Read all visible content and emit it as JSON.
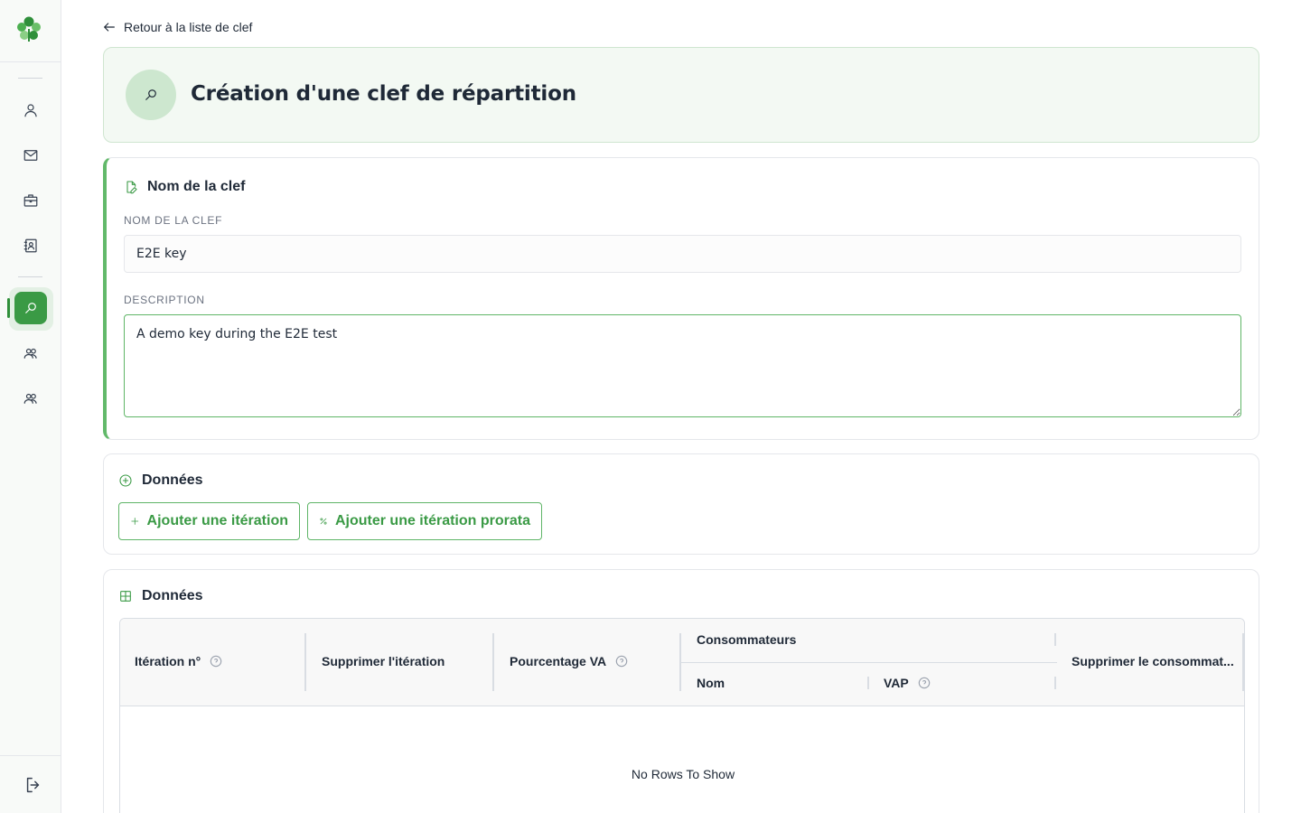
{
  "app": {
    "brand_color": "#3a9a45",
    "logo_icon": "clover-logo-icon"
  },
  "sidebar": {
    "items": [
      {
        "id": "users",
        "icon": "user-icon",
        "active": false
      },
      {
        "id": "mail",
        "icon": "mail-icon",
        "active": false
      },
      {
        "id": "briefcase",
        "icon": "briefcase-icon",
        "active": false
      },
      {
        "id": "contacts",
        "icon": "contact-book-icon",
        "active": false
      },
      {
        "id": "keys",
        "icon": "key-search-icon",
        "active": true
      },
      {
        "id": "group1",
        "icon": "users-group-icon",
        "active": false
      },
      {
        "id": "group2",
        "icon": "users-group-icon",
        "active": false
      }
    ],
    "logout_icon": "logout-icon"
  },
  "back_link": {
    "label": "Retour à la liste de clef"
  },
  "header": {
    "title": "Création d'une clef de répartition"
  },
  "name_section": {
    "title": "Nom de la clef",
    "name_label": "NOM DE LA CLEF",
    "name_value": "E2E key",
    "description_label": "DESCRIPTION",
    "description_value": "A demo key during the E2E test"
  },
  "actions_section": {
    "title": "Données",
    "add_iteration_label": "Ajouter une itération",
    "add_prorata_label": "Ajouter une itération prorata"
  },
  "table_section": {
    "title": "Données",
    "columns": {
      "iteration": "Itération n°",
      "delete_iteration": "Supprimer l'itération",
      "va_percentage": "Pourcentage VA",
      "consumers_group": "Consommateurs",
      "consumer_name": "Nom",
      "consumer_vap": "VAP",
      "delete_consumer": "Supprimer le consommat..."
    },
    "empty_text": "No Rows To Show"
  }
}
